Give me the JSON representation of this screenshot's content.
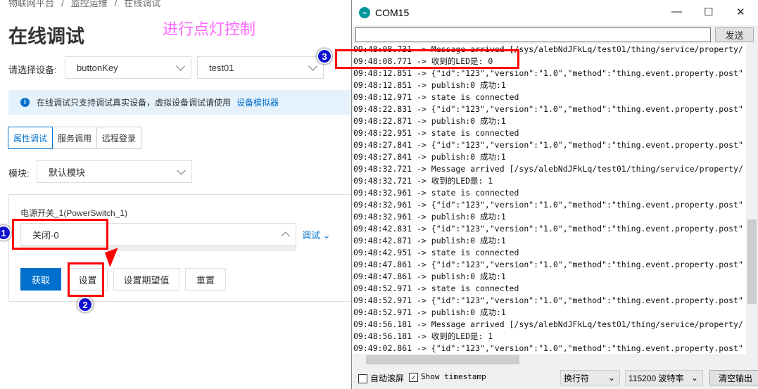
{
  "breadcrumb": [
    "物联网平台",
    "/",
    "监控运维",
    "/",
    "在线调试"
  ],
  "page_title": "在线调试",
  "annotation": "进行点灯控制",
  "device": {
    "label": "请选择设备:",
    "product": "buttonKey",
    "device": "test01"
  },
  "info": {
    "text": "在线调试只支持调试真实设备，虚拟设备调试请使用",
    "link": "设备模拟器"
  },
  "tabs": [
    "属性调试",
    "服务调用",
    "远程登录"
  ],
  "module": {
    "label": "模块:",
    "value": "默认模块"
  },
  "property": {
    "label": "电源开关_1(PowerSwitch_1)",
    "value": "关闭-0",
    "debug": "调试"
  },
  "buttons": {
    "get": "获取",
    "set": "设置",
    "set_expected": "设置期望值",
    "reset": "重置"
  },
  "badges": [
    "1",
    "2",
    "3"
  ],
  "serial": {
    "title": "COM15",
    "send": "发送",
    "lines": [
      "09:48:08.731 -> Message arrived [/sys/alebNdJFkLq/test01/thing/service/property/",
      "09:48:08.771 -> 收到的LED是: 0",
      "09:48:12.851 -> {\"id\":\"123\",\"version\":\"1.0\",\"method\":\"thing.event.property.post\"",
      "09:48:12.851 -> publish:0 成功:1",
      "09:48:12.971 -> state is connected",
      "09:48:22.831 -> {\"id\":\"123\",\"version\":\"1.0\",\"method\":\"thing.event.property.post\"",
      "09:48:22.871 -> publish:0 成功:1",
      "09:48:22.951 -> state is connected",
      "09:48:27.841 -> {\"id\":\"123\",\"version\":\"1.0\",\"method\":\"thing.event.property.post\"",
      "09:48:27.841 -> publish:0 成功:1",
      "09:48:32.721 -> Message arrived [/sys/alebNdJFkLq/test01/thing/service/property/",
      "09:48:32.721 -> 收到的LED是: 1",
      "09:48:32.961 -> state is connected",
      "09:48:32.961 -> {\"id\":\"123\",\"version\":\"1.0\",\"method\":\"thing.event.property.post\"",
      "09:48:32.961 -> publish:0 成功:1",
      "09:48:42.831 -> {\"id\":\"123\",\"version\":\"1.0\",\"method\":\"thing.event.property.post\"",
      "09:48:42.871 -> publish:0 成功:1",
      "09:48:42.951 -> state is connected",
      "09:48:47.861 -> {\"id\":\"123\",\"version\":\"1.0\",\"method\":\"thing.event.property.post\"",
      "09:48:47.861 -> publish:0 成功:1",
      "09:48:52.971 -> state is connected",
      "09:48:52.971 -> {\"id\":\"123\",\"version\":\"1.0\",\"method\":\"thing.event.property.post\"",
      "09:48:52.971 -> publish:0 成功:1",
      "09:48:56.181 -> Message arrived [/sys/alebNdJFkLq/test01/thing/service/property/",
      "09:48:56.181 -> 收到的LED是: 1",
      "09:49:02.861 -> {\"id\":\"123\",\"version\":\"1.0\",\"method\":\"thing.event.property.post\""
    ],
    "autoscroll": "自动滚屏",
    "timestamp": "Show timestamp",
    "line_ending": "换行符",
    "baud": "115200 波特率",
    "clear": "清空输出"
  }
}
